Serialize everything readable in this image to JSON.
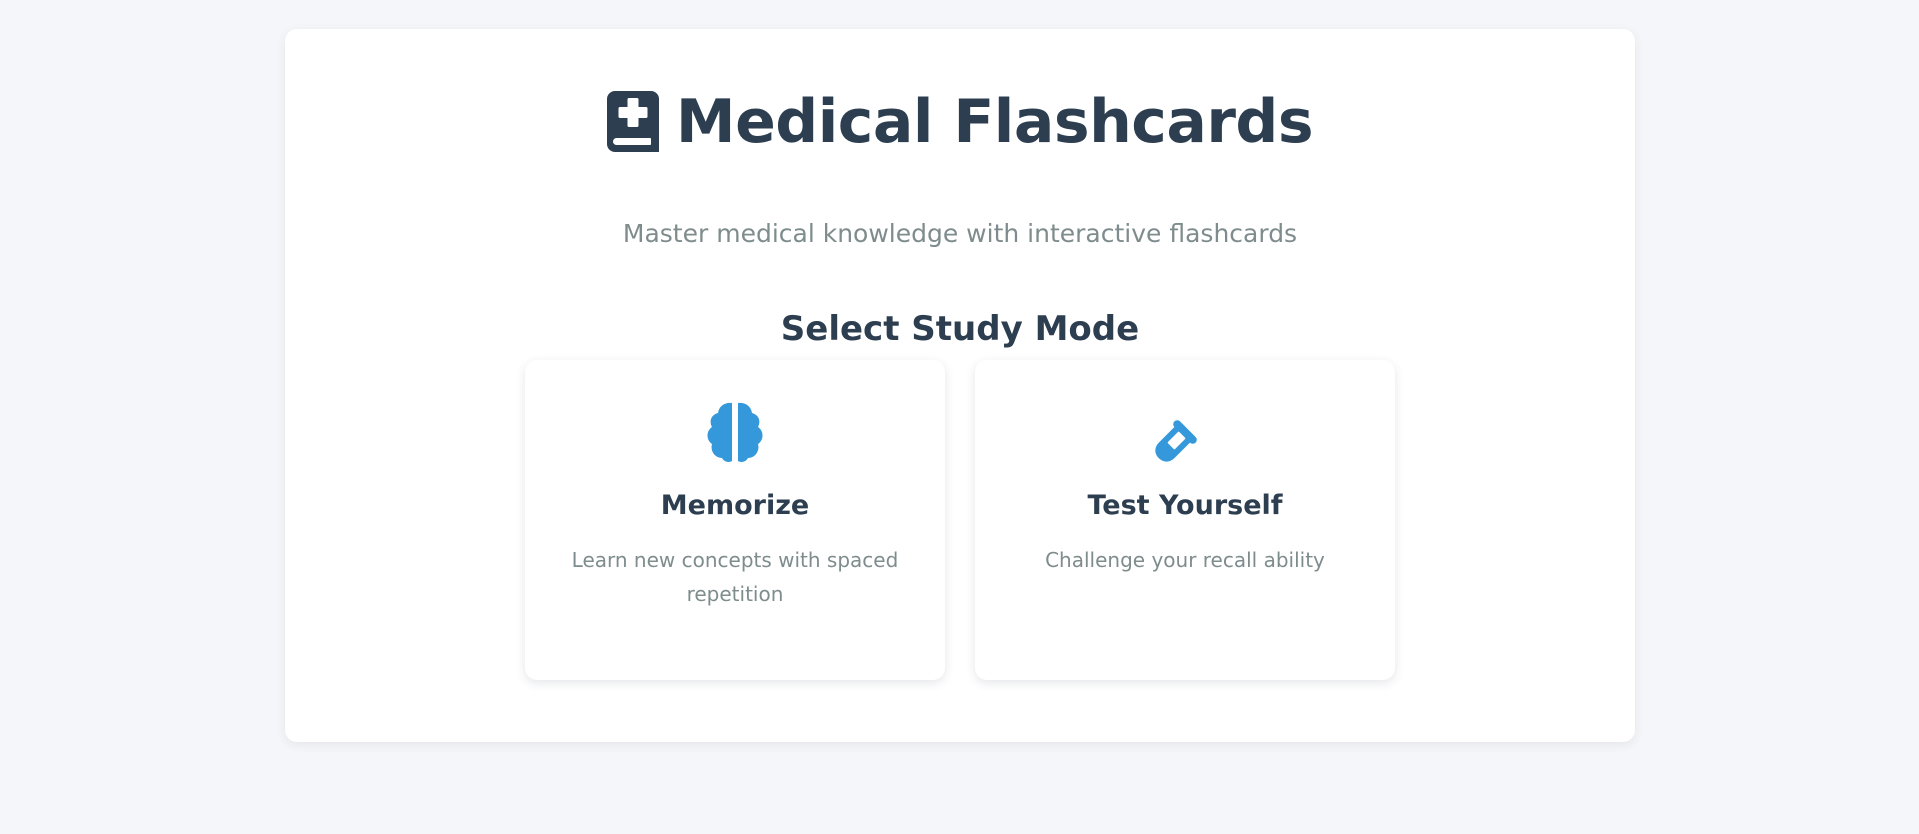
{
  "header": {
    "title": "Medical Flashcards",
    "title_icon": "book-medical-icon",
    "subtitle": "Master medical knowledge with interactive flashcards"
  },
  "mode_select": {
    "heading": "Select Study Mode",
    "modes": [
      {
        "title": "Memorize",
        "description": "Learn new concepts with spaced repetition",
        "icon": "brain-icon"
      },
      {
        "title": "Test Yourself",
        "description": "Challenge your recall ability",
        "icon": "test-tube-icon"
      }
    ]
  },
  "colors": {
    "page_background": "#f5f6f9",
    "card_background": "#ffffff",
    "heading_text": "#2c3e50",
    "muted_text": "#7f8c8d",
    "accent": "#3498db"
  }
}
